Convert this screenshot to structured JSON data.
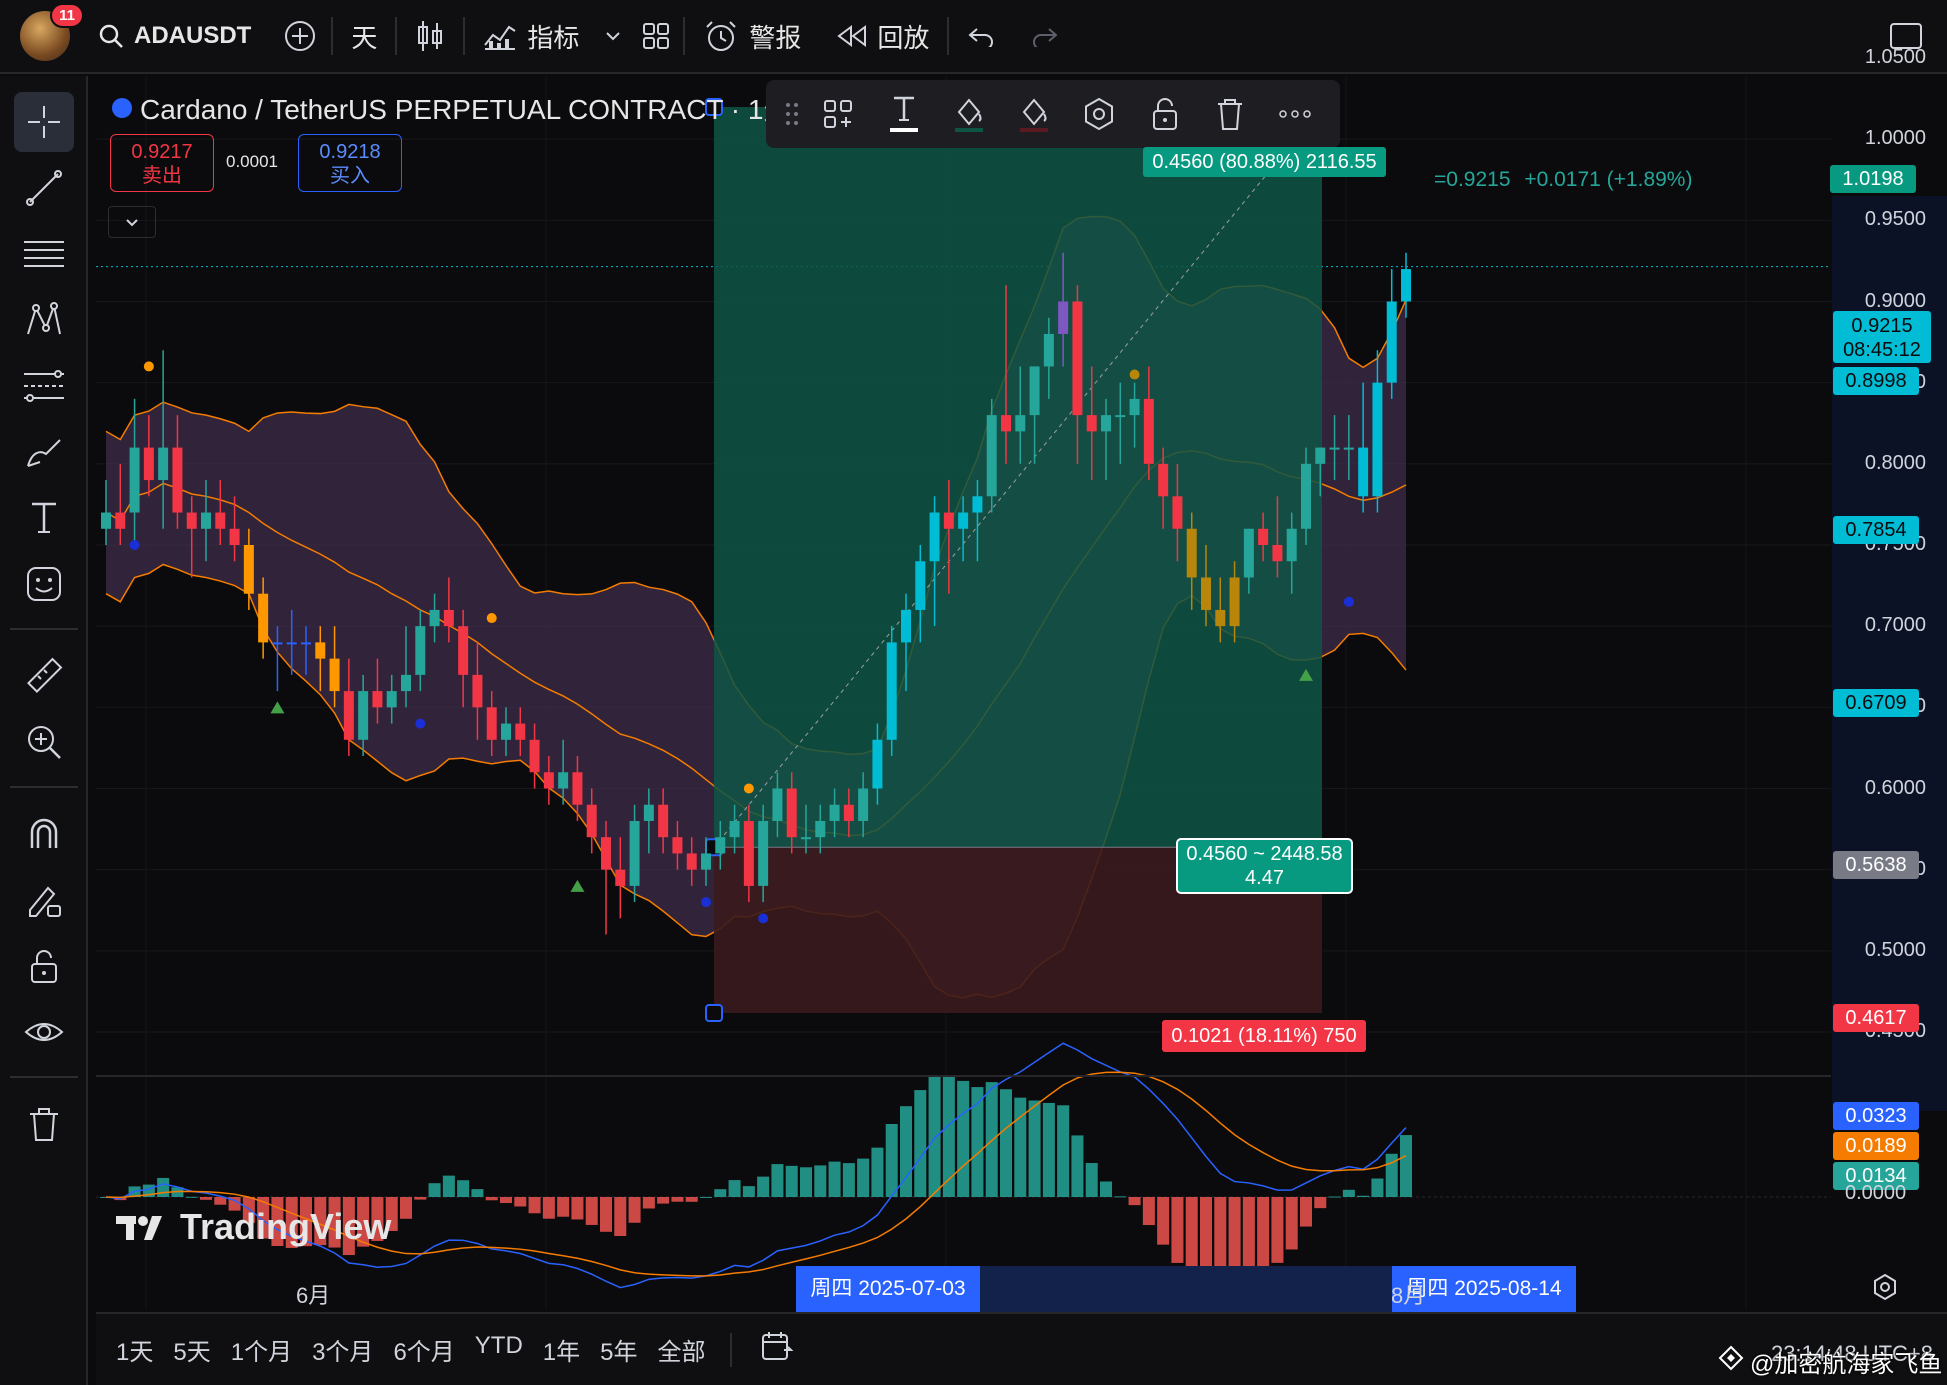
{
  "header": {
    "badge_count": "11",
    "symbol": "ADAUSDT",
    "interval": "天",
    "indicators_label": "指标",
    "alerts_label": "警报",
    "replay_label": "回放"
  },
  "legend": {
    "title": "Cardano / TetherUS PERPETUAL CONTRACT · 1天 ·",
    "ohlc_tail": "=0.9215",
    "change": "+0.0171 (+1.89%)",
    "sell_price": "0.9217",
    "sell_label": "卖出",
    "spread": "0.0001",
    "buy_price": "0.9218",
    "buy_label": "买入"
  },
  "colors": {
    "up": "#26a69a",
    "down": "#f23645",
    "accent": "#2962ff",
    "target_zone": "#0e5545",
    "stop_zone": "#3a1a1d",
    "bb_fill_purple": "#3f2c4a",
    "bb_fill_teal": "#2a4d4a"
  },
  "price_axis": {
    "ticks": [
      "1.0500",
      "1.0000",
      "0.9500",
      "0.9000",
      "0.8500",
      "0.8000",
      "0.7500",
      "0.7000",
      "0.6500",
      "0.6000",
      "0.5500",
      "0.5000",
      "0.4500"
    ],
    "tags": {
      "target": "1.0198",
      "last_price": "0.9215",
      "countdown": "08:45:12",
      "bb_upper": "0.8998",
      "bb_mid": "0.7854",
      "bb_lower": "0.6709",
      "entry": "0.5638",
      "stop": "0.4617"
    }
  },
  "position_tool": {
    "target_label": "0.4560 (80.88%) 2116.55",
    "center_line1": "0.4560 ~ 2448.58",
    "center_line2": "4.47",
    "stop_label": "0.1021 (18.11%) 750"
  },
  "macd_axis": {
    "macd": "0.0323",
    "signal": "0.0189",
    "hist": "0.0134",
    "zero": "0.0000"
  },
  "time_axis": {
    "june": "6月",
    "august": "8月",
    "start_date": "周四 2025-07-03",
    "end_date": "周四 2025-08-14"
  },
  "branding": {
    "logo_text": "TradingView",
    "watermark": "@加密航海家飞鱼"
  },
  "range_buttons": [
    "1天",
    "5天",
    "1个月",
    "3个月",
    "6个月",
    "YTD",
    "1年",
    "5年",
    "全部"
  ],
  "clock": "23:14:48 UTC+8",
  "chart_data": {
    "type": "candlestick",
    "symbol": "ADAUSDT",
    "interval": "1D",
    "ylim": [
      0.43,
      1.07
    ],
    "candles": [
      [
        0.76,
        0.79,
        0.75,
        0.77
      ],
      [
        0.77,
        0.8,
        0.75,
        0.76
      ],
      [
        0.77,
        0.84,
        0.75,
        0.81
      ],
      [
        0.81,
        0.83,
        0.78,
        0.79
      ],
      [
        0.79,
        0.87,
        0.76,
        0.81
      ],
      [
        0.81,
        0.83,
        0.76,
        0.77
      ],
      [
        0.77,
        0.78,
        0.73,
        0.76
      ],
      [
        0.76,
        0.79,
        0.74,
        0.77
      ],
      [
        0.77,
        0.79,
        0.75,
        0.76
      ],
      [
        0.76,
        0.78,
        0.74,
        0.75
      ],
      [
        0.75,
        0.76,
        0.71,
        0.72
      ],
      [
        0.72,
        0.73,
        0.68,
        0.69
      ],
      [
        0.69,
        0.7,
        0.66,
        0.69
      ],
      [
        0.69,
        0.71,
        0.67,
        0.69
      ],
      [
        0.69,
        0.7,
        0.67,
        0.69
      ],
      [
        0.69,
        0.7,
        0.66,
        0.68
      ],
      [
        0.68,
        0.7,
        0.65,
        0.66
      ],
      [
        0.66,
        0.68,
        0.62,
        0.63
      ],
      [
        0.63,
        0.67,
        0.62,
        0.66
      ],
      [
        0.66,
        0.68,
        0.64,
        0.65
      ],
      [
        0.65,
        0.67,
        0.64,
        0.66
      ],
      [
        0.66,
        0.7,
        0.65,
        0.67
      ],
      [
        0.67,
        0.71,
        0.66,
        0.7
      ],
      [
        0.7,
        0.72,
        0.69,
        0.71
      ],
      [
        0.71,
        0.73,
        0.69,
        0.7
      ],
      [
        0.7,
        0.71,
        0.65,
        0.67
      ],
      [
        0.67,
        0.69,
        0.63,
        0.65
      ],
      [
        0.65,
        0.66,
        0.62,
        0.63
      ],
      [
        0.63,
        0.65,
        0.62,
        0.64
      ],
      [
        0.64,
        0.65,
        0.62,
        0.63
      ],
      [
        0.63,
        0.64,
        0.6,
        0.61
      ],
      [
        0.61,
        0.62,
        0.59,
        0.6
      ],
      [
        0.6,
        0.63,
        0.59,
        0.61
      ],
      [
        0.61,
        0.62,
        0.58,
        0.59
      ],
      [
        0.59,
        0.6,
        0.56,
        0.57
      ],
      [
        0.57,
        0.58,
        0.51,
        0.55
      ],
      [
        0.55,
        0.57,
        0.52,
        0.54
      ],
      [
        0.54,
        0.59,
        0.53,
        0.58
      ],
      [
        0.58,
        0.6,
        0.56,
        0.59
      ],
      [
        0.59,
        0.6,
        0.56,
        0.57
      ],
      [
        0.57,
        0.58,
        0.55,
        0.56
      ],
      [
        0.56,
        0.57,
        0.54,
        0.55
      ],
      [
        0.55,
        0.57,
        0.54,
        0.56
      ],
      [
        0.56,
        0.58,
        0.55,
        0.57
      ],
      [
        0.57,
        0.59,
        0.56,
        0.58
      ],
      [
        0.58,
        0.59,
        0.53,
        0.54
      ],
      [
        0.54,
        0.59,
        0.53,
        0.58
      ],
      [
        0.58,
        0.61,
        0.57,
        0.6
      ],
      [
        0.6,
        0.61,
        0.56,
        0.57
      ],
      [
        0.57,
        0.59,
        0.56,
        0.57
      ],
      [
        0.57,
        0.59,
        0.56,
        0.58
      ],
      [
        0.58,
        0.6,
        0.57,
        0.59
      ],
      [
        0.59,
        0.6,
        0.57,
        0.58
      ],
      [
        0.58,
        0.61,
        0.57,
        0.6
      ],
      [
        0.6,
        0.64,
        0.59,
        0.63
      ],
      [
        0.63,
        0.7,
        0.62,
        0.69
      ],
      [
        0.69,
        0.72,
        0.66,
        0.71
      ],
      [
        0.71,
        0.75,
        0.69,
        0.74
      ],
      [
        0.74,
        0.78,
        0.7,
        0.77
      ],
      [
        0.77,
        0.79,
        0.72,
        0.76
      ],
      [
        0.76,
        0.78,
        0.74,
        0.77
      ],
      [
        0.77,
        0.79,
        0.74,
        0.78
      ],
      [
        0.78,
        0.84,
        0.77,
        0.83
      ],
      [
        0.83,
        0.91,
        0.8,
        0.82
      ],
      [
        0.82,
        0.86,
        0.8,
        0.83
      ],
      [
        0.83,
        0.86,
        0.8,
        0.86
      ],
      [
        0.86,
        0.89,
        0.84,
        0.88
      ],
      [
        0.88,
        0.93,
        0.86,
        0.9
      ],
      [
        0.9,
        0.91,
        0.8,
        0.83
      ],
      [
        0.83,
        0.86,
        0.79,
        0.82
      ],
      [
        0.82,
        0.84,
        0.79,
        0.83
      ],
      [
        0.83,
        0.85,
        0.8,
        0.83
      ],
      [
        0.83,
        0.85,
        0.81,
        0.84
      ],
      [
        0.84,
        0.86,
        0.79,
        0.8
      ],
      [
        0.8,
        0.81,
        0.76,
        0.78
      ],
      [
        0.78,
        0.8,
        0.74,
        0.76
      ],
      [
        0.76,
        0.77,
        0.71,
        0.73
      ],
      [
        0.73,
        0.75,
        0.7,
        0.71
      ],
      [
        0.71,
        0.73,
        0.69,
        0.7
      ],
      [
        0.7,
        0.74,
        0.69,
        0.73
      ],
      [
        0.73,
        0.76,
        0.72,
        0.76
      ],
      [
        0.76,
        0.77,
        0.74,
        0.75
      ],
      [
        0.75,
        0.78,
        0.73,
        0.74
      ],
      [
        0.74,
        0.77,
        0.72,
        0.76
      ],
      [
        0.76,
        0.81,
        0.75,
        0.8
      ],
      [
        0.8,
        0.81,
        0.78,
        0.81
      ],
      [
        0.81,
        0.83,
        0.79,
        0.81
      ],
      [
        0.81,
        0.83,
        0.79,
        0.81
      ],
      [
        0.81,
        0.85,
        0.77,
        0.78
      ],
      [
        0.78,
        0.87,
        0.77,
        0.85
      ],
      [
        0.85,
        0.92,
        0.84,
        0.9
      ],
      [
        0.9,
        0.93,
        0.89,
        0.92
      ]
    ]
  }
}
